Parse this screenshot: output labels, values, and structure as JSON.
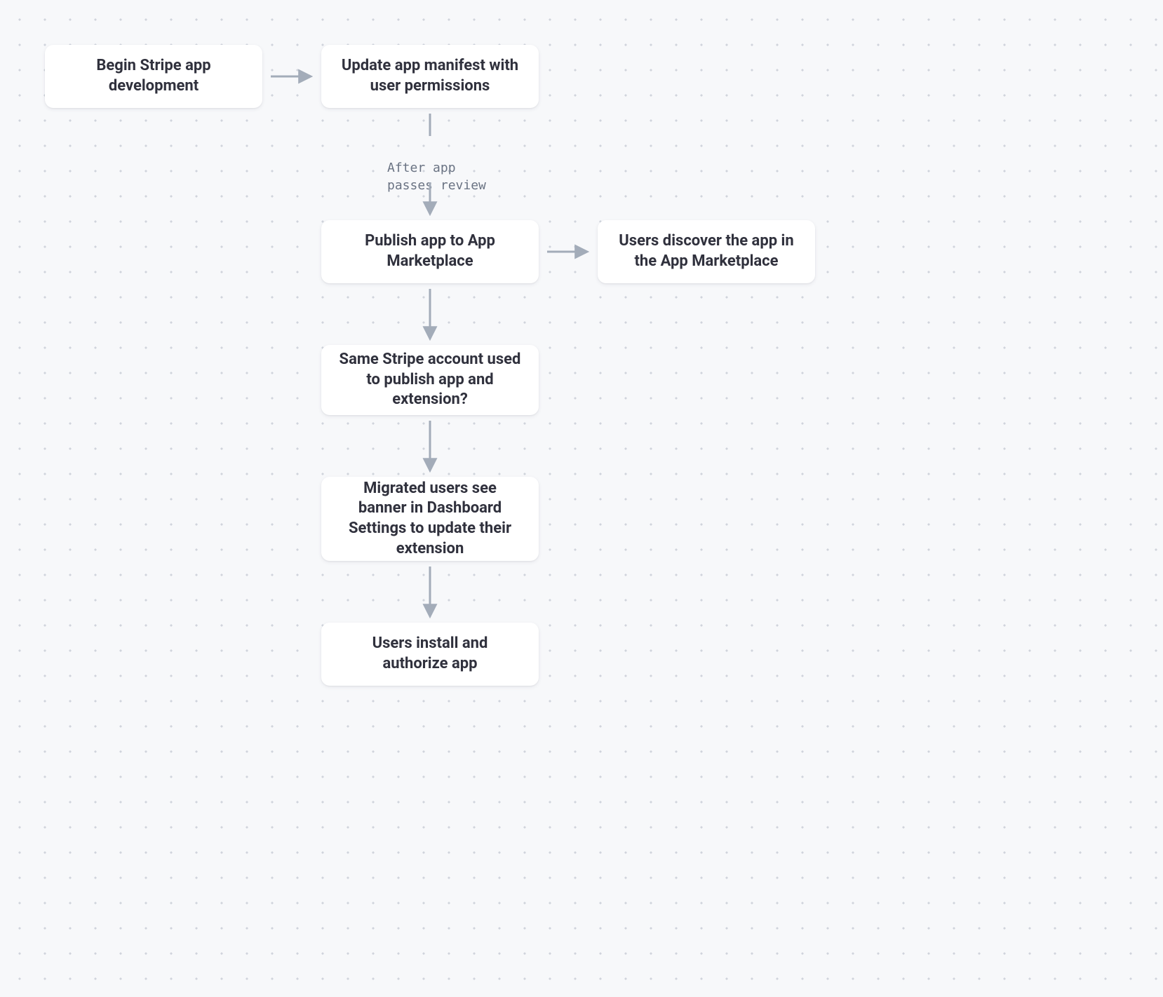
{
  "nodes": {
    "begin": "Begin Stripe app development",
    "manifest": "Update app manifest with user permissions",
    "publish": "Publish app to App Marketplace",
    "discover": "Users discover the app in the App Marketplace",
    "same_account": "Same Stripe account used to publish app and extension?",
    "banner": "Migrated users see banner in Dashboard Settings to update their extension",
    "install": "Users install and authorize app"
  },
  "annotation": {
    "review": "After app\npasses review"
  },
  "colors": {
    "node_bg": "#ffffff",
    "node_text": "#30313d",
    "annotation_text": "#6a7383",
    "arrow": "#a3acb9",
    "canvas_bg": "#f7f8fa",
    "dot": "#d0d4dc"
  },
  "diagram_structure": {
    "edges": [
      {
        "from": "begin",
        "to": "manifest",
        "dir": "right"
      },
      {
        "from": "manifest",
        "to": "publish",
        "dir": "down",
        "label": "After app passes review"
      },
      {
        "from": "publish",
        "to": "discover",
        "dir": "right"
      },
      {
        "from": "publish",
        "to": "same_account",
        "dir": "down"
      },
      {
        "from": "same_account",
        "to": "banner",
        "dir": "down"
      },
      {
        "from": "banner",
        "to": "install",
        "dir": "down"
      }
    ]
  }
}
